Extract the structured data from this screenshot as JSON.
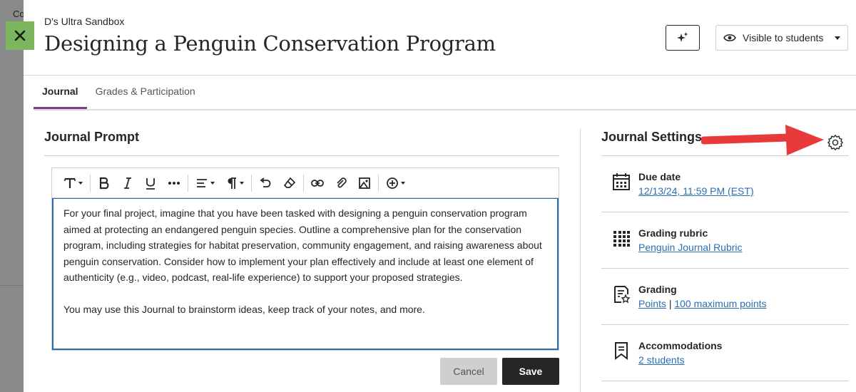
{
  "background": {
    "text": "Co"
  },
  "header": {
    "course_name": "D's Ultra Sandbox",
    "title": "Designing a Penguin Conservation Program",
    "visibility_label": "Visible to students"
  },
  "tabs": [
    {
      "label": "Journal",
      "active": true
    },
    {
      "label": "Grades & Participation",
      "active": false
    }
  ],
  "prompt": {
    "heading": "Journal Prompt",
    "paragraphs": [
      "For your final project, imagine that you have been tasked with designing a penguin conservation program aimed at protecting an endangered penguin species. Outline a comprehensive plan for the conservation program, including strategies for habitat preservation, community engagement, and raising awareness about penguin conservation. Consider how to implement your plan effectively and include at least one element of authenticity (e.g., video, podcast, real-life experience) to support your proposed strategies.",
      "You may use this Journal to brainstorm ideas, keep track of your notes, and more."
    ],
    "toolbar_icons": [
      "text-style-icon",
      "bold-icon",
      "italic-icon",
      "underline-icon",
      "more-icon",
      "align-icon",
      "paragraph-icon",
      "undo-icon",
      "eraser-icon",
      "link-icon",
      "attach-icon",
      "image-icon",
      "insert-icon"
    ]
  },
  "actions": {
    "cancel_label": "Cancel",
    "save_label": "Save"
  },
  "settings": {
    "heading": "Journal Settings",
    "due_date": {
      "label": "Due date",
      "value": "12/13/24, 11:59 PM (EST)"
    },
    "rubric": {
      "label": "Grading rubric",
      "value": "Penguin Journal Rubric"
    },
    "grading": {
      "label": "Grading",
      "scheme": "Points",
      "separator": "|",
      "max": "100 maximum points"
    },
    "accommodations": {
      "label": "Accommodations",
      "value": "2 students"
    }
  },
  "colors": {
    "accent_tab": "#7e3b94",
    "link": "#2a6fb3",
    "close_button": "#7cb65e",
    "annotation_arrow": "#e83a3a"
  }
}
